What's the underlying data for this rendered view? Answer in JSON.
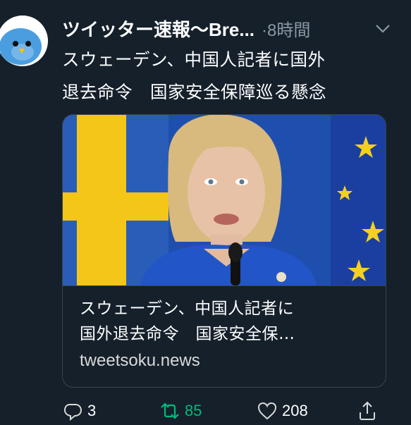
{
  "account": {
    "name": "ツイッター速報〜Bre...",
    "time": "·8時間"
  },
  "tweet": {
    "text": "スウェーデン、中国人記者に国外\n退去命令　国家安全保障巡る懸念"
  },
  "card": {
    "title": "スウェーデン、中国人記者に\n国外退去命令　国家安全保…",
    "domain": "tweetsoku.news"
  },
  "actions": {
    "replies": "3",
    "retweets": "85",
    "likes": "208"
  },
  "colors": {
    "background": "#15202b",
    "retweet_active": "#00ba7c",
    "muted": "#8b98a5"
  },
  "icons": [
    "bird-avatar",
    "chevron-down-icon",
    "reply-icon",
    "retweet-icon",
    "like-icon",
    "share-icon"
  ]
}
